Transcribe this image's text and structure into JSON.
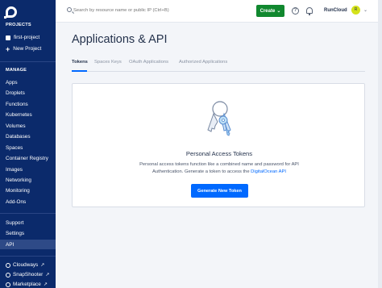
{
  "sidebar": {
    "projects_heading": "PROJECTS",
    "project_name": "first-project",
    "new_project_label": "New Project",
    "manage_heading": "MANAGE",
    "manage_items": [
      "Apps",
      "Droplets",
      "Functions",
      "Kubernetes",
      "Volumes",
      "Databases",
      "Spaces",
      "Container Registry",
      "Images",
      "Networking",
      "Monitoring",
      "Add-Ons"
    ],
    "bottom_items": [
      "Support",
      "Settings",
      "API"
    ],
    "active_item": "API",
    "external_links": [
      "Cloudways",
      "SnapShooter",
      "Marketplace"
    ]
  },
  "topbar": {
    "search_placeholder": "Search by resource name or public IP (Ctrl+B)",
    "create_label": "Create",
    "help_icon": "help-icon",
    "bell_icon": "bell-icon",
    "account_name": "RunCloud",
    "avatar_initial": "R"
  },
  "page": {
    "title": "Applications & API",
    "tabs": [
      "Tokens",
      "Spaces Keys",
      "OAuth Applications",
      "Authorized Applications"
    ],
    "active_tab": "Tokens"
  },
  "card": {
    "title": "Personal Access Tokens",
    "desc_line1": "Personal access tokens function like a combined name and password for API",
    "desc_line2_prefix": "Authentication. Generate a token to access the ",
    "desc_link": "DigitalOcean API",
    "button_label": "Generate New Token"
  },
  "colors": {
    "sidebar_bg": "#0b2a6b",
    "primary_blue": "#0069ff",
    "create_green": "#11882f",
    "avatar_yellow": "#d4e21a"
  }
}
